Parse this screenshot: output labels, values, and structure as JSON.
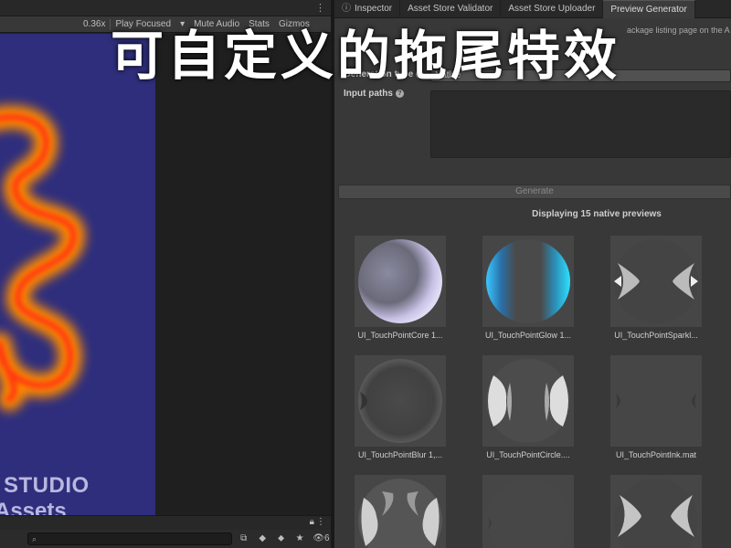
{
  "overlay": {
    "title": "可自定义的拖尾特效"
  },
  "left": {
    "toolbar": {
      "scale": "0.36x",
      "focused": "Play Focused",
      "mute": "Mute Audio",
      "stats": "Stats",
      "gizmos": "Gizmos"
    },
    "watermark": {
      "line1": "STUDIO",
      "line2": "Assets"
    },
    "search": {
      "placeholder": ""
    },
    "layer_count": "6"
  },
  "right": {
    "tabs": [
      {
        "label": "Inspector",
        "icon": "info-icon",
        "active": false
      },
      {
        "label": "Asset Store Validator",
        "active": false
      },
      {
        "label": "Asset Store Uploader",
        "active": false
      },
      {
        "label": "Preview Generator",
        "active": true
      }
    ],
    "description_right": "ackage listing page on the A",
    "generation_type": {
      "label": "Generation type",
      "value": "Native"
    },
    "input_paths": {
      "label": "Input paths"
    },
    "generate_label": "Generate",
    "display_count": "Displaying 15 native previews",
    "previews": [
      {
        "caption": "UI_TouchPointCore 1...",
        "kind": "core"
      },
      {
        "caption": "UI_TouchPointGlow 1...",
        "kind": "glow"
      },
      {
        "caption": "UI_TouchPointSparkl...",
        "kind": "sparkle"
      },
      {
        "caption": "UI_TouchPointBlur 1,...",
        "kind": "blur"
      },
      {
        "caption": "UI_TouchPointCircle....",
        "kind": "circle"
      },
      {
        "caption": "UI_TouchPointInk.mat",
        "kind": "ink"
      },
      {
        "caption": "",
        "kind": "swirl"
      },
      {
        "caption": "",
        "kind": "faint"
      },
      {
        "caption": "",
        "kind": "sparkle"
      }
    ]
  },
  "colors": {
    "game_bg": "#2e2e7c",
    "trail_outer": "#ff8a00",
    "trail_inner": "#ff3a10",
    "editor_bg": "#383838"
  }
}
